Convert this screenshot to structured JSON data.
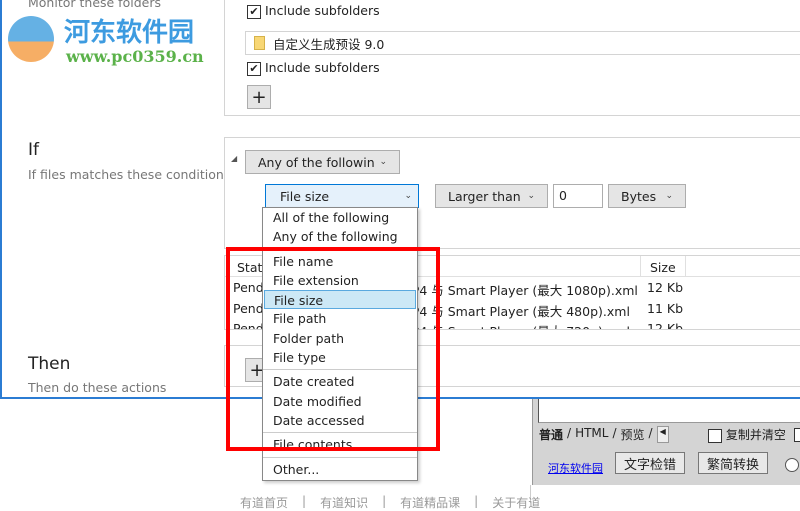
{
  "watermark": {
    "name": "河东软件园",
    "url": "www.pc0359.cn"
  },
  "monitor": {
    "title": "Monitor these folders",
    "folders": [
      {
        "include": "Include subfolders"
      },
      {
        "name": "自定义生成预设 9.0",
        "include": "Include subfolders"
      }
    ],
    "add": "+"
  },
  "if": {
    "title": "If",
    "subtitle": "If files matches these conditions",
    "group_select": "Any of the followin",
    "field_select": "File size",
    "op_select": "Larger than",
    "value": "0",
    "unit_select": "Bytes"
  },
  "menu": {
    "items": [
      "All of the following",
      "Any of the following",
      "File name",
      "File extension",
      "File size",
      "File path",
      "Folder path",
      "File type",
      "Date created",
      "Date modified",
      "Date accessed",
      "File contents",
      "Other..."
    ],
    "selected": "File size"
  },
  "table": {
    "headers": [
      "Status",
      "Size"
    ],
    "rows": [
      {
        "status": "Pending",
        "name": "MP4 与 Smart Player (最大 1080p).xml",
        "size": "12 Kb"
      },
      {
        "status": "Pending",
        "name": "MP4 与 Smart Player (最大 480p).xml",
        "size": "11 Kb"
      },
      {
        "status": "Pending",
        "name": "MP4 与 Smart Player (最大 720p).xml",
        "size": "12 Kb"
      }
    ]
  },
  "then": {
    "title": "Then",
    "subtitle": "Then do these actions",
    "add": "+"
  },
  "bottom": {
    "tabs": [
      "普通",
      "HTML",
      "预览"
    ],
    "copy_clear": "复制并清空",
    "link": "河东软件园",
    "btn1": "文字检错",
    "btn2": "繁简转换"
  },
  "footer": [
    "有道首页",
    "有道知识",
    "有道精品课",
    "关于有道"
  ],
  "colors": {
    "accent": "#2b7cd3",
    "highlight": "#cce8f6",
    "annotation": "#ff0000"
  }
}
